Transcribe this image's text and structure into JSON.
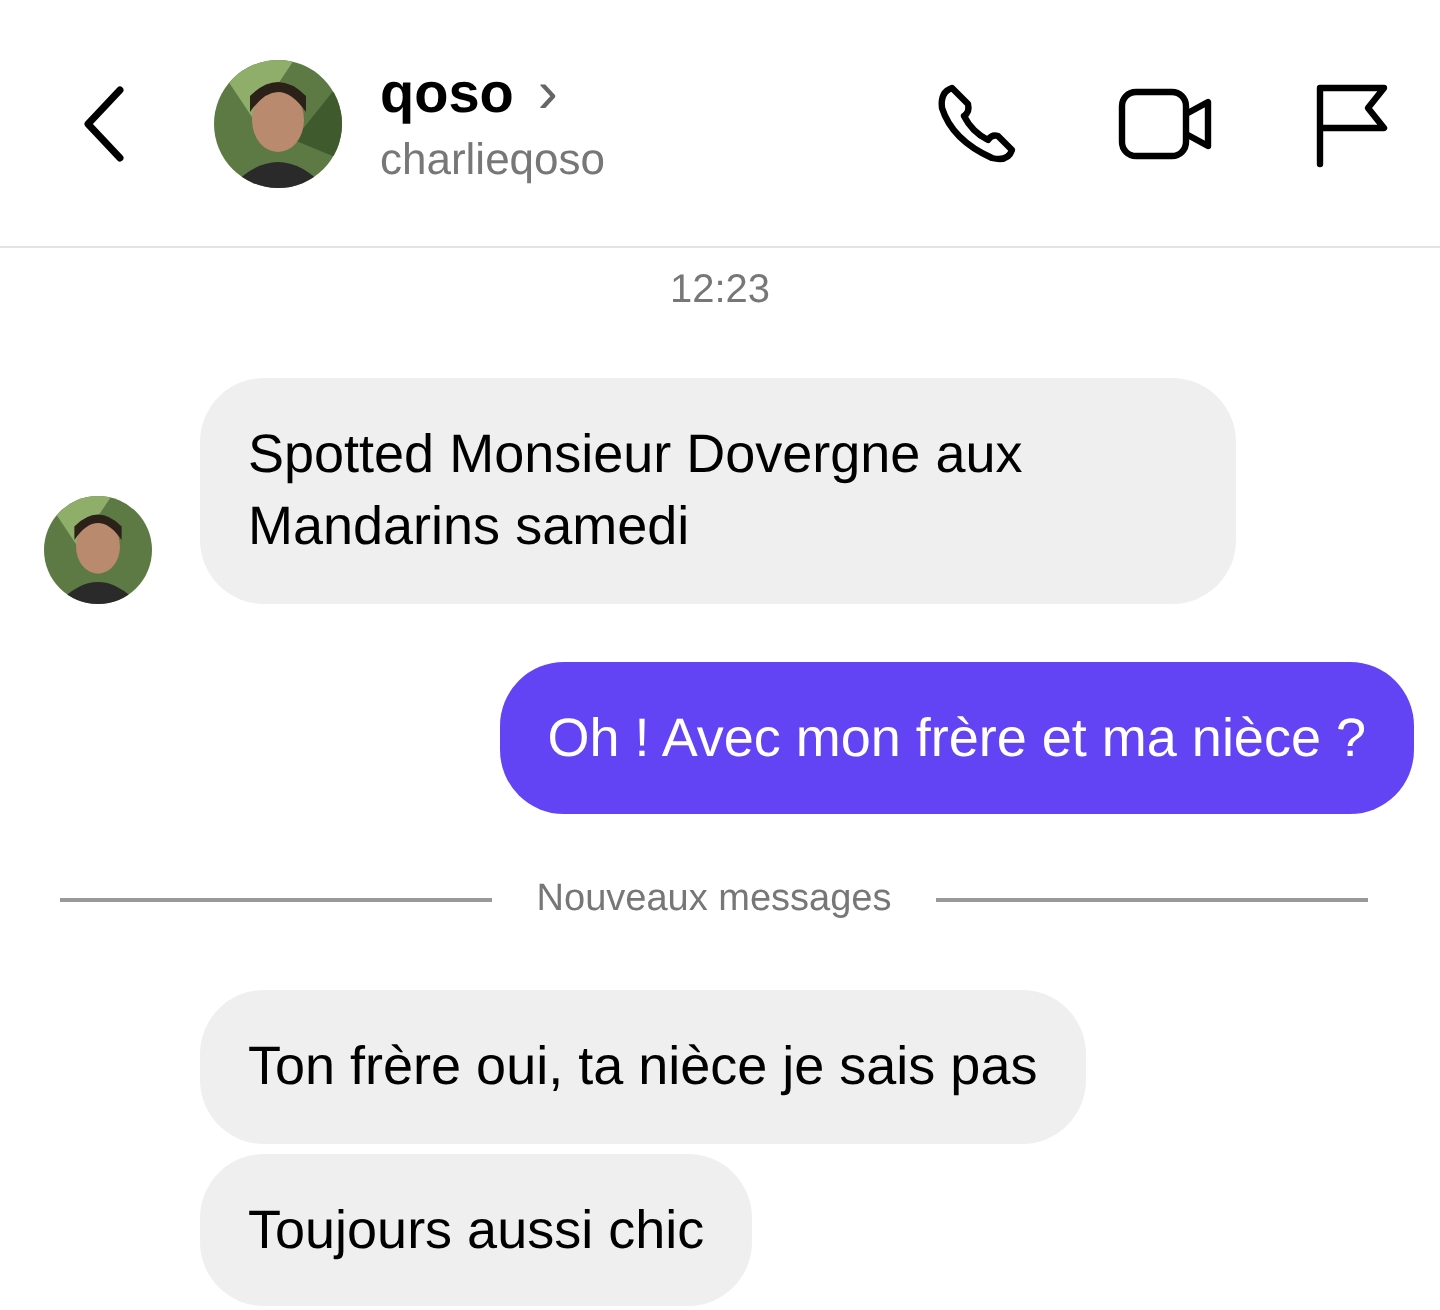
{
  "header": {
    "name": "qoso",
    "chevron": "›",
    "username": "charlieqoso"
  },
  "timestamp": "12:23",
  "messages": [
    {
      "kind": "incoming",
      "text": "Spotted Monsieur Dovergne aux Mandarins samedi",
      "show_avatar": true
    },
    {
      "kind": "outgoing",
      "text": "Oh ! Avec mon frère et ma nièce ?"
    },
    {
      "kind": "divider",
      "text": "Nouveaux messages"
    },
    {
      "kind": "incoming",
      "text": "Ton frère oui, ta nièce je sais pas",
      "show_avatar": false
    },
    {
      "kind": "incoming",
      "text": "Toujours aussi chic",
      "show_avatar": false
    }
  ]
}
